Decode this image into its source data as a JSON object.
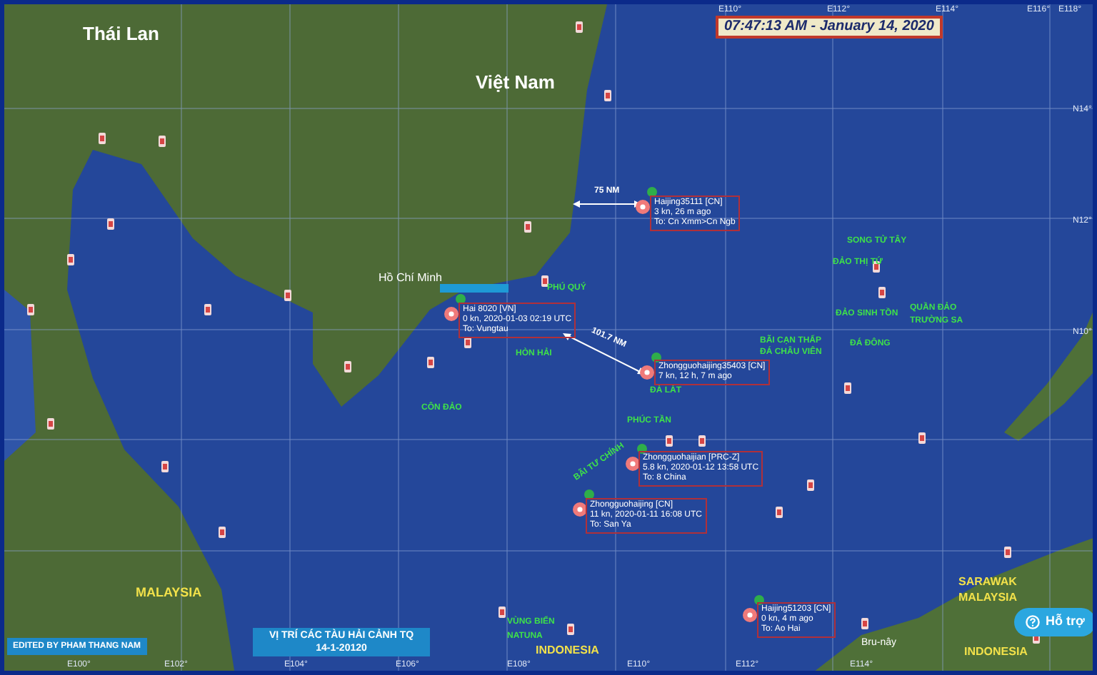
{
  "timestamp": "07:47:13 AM - January 14, 2020",
  "grid_labels": [
    {
      "text": "E110°"
    },
    {
      "text": "E112°"
    },
    {
      "text": "E114°"
    },
    {
      "text": "E116°"
    },
    {
      "text": "E118°"
    },
    {
      "text": "E100°"
    },
    {
      "text": "E102°"
    },
    {
      "text": "E104°"
    },
    {
      "text": "E106°"
    },
    {
      "text": "E108°"
    },
    {
      "text": "E110°"
    },
    {
      "text": "E112°"
    },
    {
      "text": "E114°"
    },
    {
      "text": "N14°"
    },
    {
      "text": "N12°"
    },
    {
      "text": "N10°"
    }
  ],
  "country_labels": [
    {
      "text": "Thái Lan"
    },
    {
      "text": "Việt Nam"
    },
    {
      "text": "Hồ Chí Minh"
    },
    {
      "text": "MALAYSIA"
    },
    {
      "text": "SARAWAK"
    },
    {
      "text": "MALAYSIA"
    },
    {
      "text": "Bru-nây"
    },
    {
      "text": "INDONESIA"
    },
    {
      "text": "INDONESIA"
    }
  ],
  "place_labels": [
    {
      "text": "PHÚ QUÝ"
    },
    {
      "text": "HÒN HẢI"
    },
    {
      "text": "CÔN ĐẢO"
    },
    {
      "text": "ĐÁ LÁT"
    },
    {
      "text": "PHÚC TẦN"
    },
    {
      "text": "BÃI TƯ CHÍNH"
    },
    {
      "text": "BÃI CẠN THẤP"
    },
    {
      "text": "ĐÁ CHÂU VIÊN"
    },
    {
      "text": "SONG TỬ TÂY"
    },
    {
      "text": "ĐẢO THỊ TỨ"
    },
    {
      "text": "ĐẢO SINH TỒN"
    },
    {
      "text": "ĐÁ ĐÔNG"
    },
    {
      "text": "QUẦN ĐẢO"
    },
    {
      "text": "TRƯỜNG SA"
    },
    {
      "text": "VÙNG BIỂN"
    },
    {
      "text": "NATUNA"
    }
  ],
  "vessels": [
    {
      "lines": [
        "Haijing35111 [CN]",
        "3 kn, 26 m ago",
        "To: Cn Xmm>Cn Ngb"
      ]
    },
    {
      "lines": [
        "Zhongguohaijing35403 [CN]",
        "7 kn, 12 h, 7 m ago"
      ]
    },
    {
      "lines": [
        "Zhongguohaijian [PRC-Z]",
        "5.8 kn, 2020-01-12 13:58 UTC",
        "To: 8 China"
      ]
    },
    {
      "lines": [
        "Zhongguohaijing [CN]",
        "11 kn, 2020-01-11 16:08 UTC",
        "To: San Ya"
      ]
    },
    {
      "lines": [
        "Haijing51203 [CN]",
        "0 kn, 4 m ago",
        "To: Ao Hai"
      ]
    },
    {
      "lines": [
        "Hai 8020 [VN]",
        "0 kn, 2020-01-03 02:19 UTC",
        "To: Vungtau"
      ]
    }
  ],
  "distances": [
    {
      "text": "75 NM"
    },
    {
      "text": "101.7 NM"
    }
  ],
  "caption": {
    "lines": [
      "VỊ TRÍ CÁC TÀU HẢI CẢNH TQ",
      "14-1-20120"
    ]
  },
  "credit": "EDITED BY PHAM THANG NAM",
  "help_button": "Hỗ trợ"
}
